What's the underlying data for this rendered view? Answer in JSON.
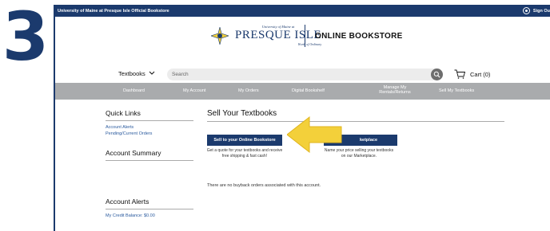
{
  "step_number": "3",
  "topbar": {
    "store_name": "University of Maine at Presque Isle Official Bookstore",
    "signout_label": "Sign Ou"
  },
  "logo": {
    "small_text": "University of Maine at",
    "big_text": "PRESQUE ISLE",
    "tagline": "Worth of Ordinary"
  },
  "store_title": "ONLINE BOOKSTORE",
  "search": {
    "dropdown_label": "Textbooks",
    "placeholder": "Search"
  },
  "cart_label": "Cart (0)",
  "nav": {
    "items": [
      {
        "label": "Dashboard"
      },
      {
        "label": "My Account"
      },
      {
        "label": "My Orders"
      },
      {
        "label": "Digital Bookshelf"
      },
      {
        "label": "Manage My Rentals/Returns"
      },
      {
        "label": "Sell My Textbooks"
      }
    ]
  },
  "sidebar": {
    "quick_links_heading": "Quick Links",
    "quick_links": [
      "Account Alerts",
      "Pending/Current Orders"
    ],
    "account_summary_heading": "Account Summary",
    "account_alerts_heading": "Account Alerts",
    "credit_balance": "My Credit Balance: $0.00"
  },
  "main": {
    "title": "Sell Your Textbooks",
    "sell_online_button": "Sell to your Online Bookstore",
    "sell_online_desc": "Get a quote for your textbooks and receive free shipping & fast cash!",
    "marketplace_button": "ketplace",
    "marketplace_desc": "Name your price selling your textbooks on our Marketplace.",
    "no_orders_text": "There are no buyback orders associated with this account."
  },
  "colors": {
    "brand_navy": "#1b3a6d",
    "nav_gray": "#a9abad",
    "arrow_yellow": "#f3d03a",
    "link_blue": "#2a5a9e"
  }
}
